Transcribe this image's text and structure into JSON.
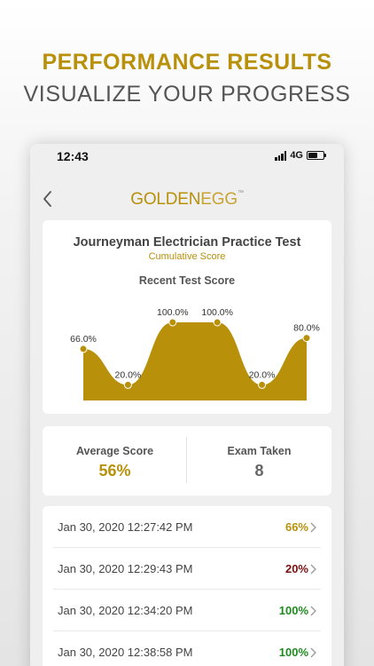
{
  "colors": {
    "gold": "#b8900a",
    "dark_red": "#7a1010",
    "green": "#1f8a1f",
    "gray_text": "#555555"
  },
  "promo": {
    "headline": "PERFORMANCE RESULTS",
    "subheadline": "VISUALIZE YOUR PROGRESS"
  },
  "status_bar": {
    "time": "12:43",
    "network": "4G",
    "icons": [
      "signal-icon",
      "battery-icon"
    ]
  },
  "nav": {
    "back_icon": "chevron-left-icon",
    "logo_part1": "GOLDEN",
    "logo_part2": "EGG",
    "logo_mark": "™"
  },
  "test": {
    "title": "Journeyman Electrician Practice Test",
    "subtitle": "Cumulative Score"
  },
  "chart_data": {
    "type": "area",
    "title": "Recent Test Score",
    "values": [
      66,
      20,
      100,
      100,
      20,
      80
    ],
    "labels": [
      "66.0%",
      "20.0%",
      "100.0%",
      "100.0%",
      "20.0%",
      "80.0%"
    ],
    "ylim": [
      0,
      100
    ],
    "grid": false,
    "legend": "none"
  },
  "stats": {
    "average_label": "Average Score",
    "average_value": "56%",
    "exams_label": "Exam Taken",
    "exams_value": "8"
  },
  "history": [
    {
      "date": "Jan 30, 2020 12:27:42 PM",
      "score": "66%",
      "color": "#b8900a"
    },
    {
      "date": "Jan 30, 2020 12:29:43 PM",
      "score": "20%",
      "color": "#7a1010"
    },
    {
      "date": "Jan 30, 2020 12:34:20 PM",
      "score": "100%",
      "color": "#1f8a1f"
    },
    {
      "date": "Jan 30, 2020 12:38:58 PM",
      "score": "100%",
      "color": "#1f8a1f"
    }
  ]
}
